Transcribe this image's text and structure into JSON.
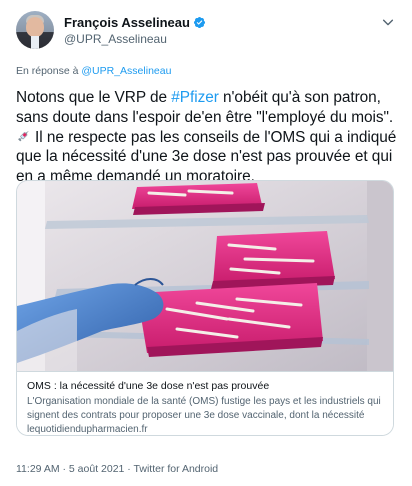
{
  "author": {
    "display_name": "François Asselineau",
    "handle": "@UPR_Asselineau",
    "verified": true
  },
  "reply": {
    "prefix": "En réponse à",
    "mention": "@UPR_Asselineau"
  },
  "tweet": {
    "line1_a": "Notons que le VRP de ",
    "hashtag": "#Pfizer",
    "line1_b": " n'obéit qu'à son patron, sans doute dans l'espoir de'en être \"l'employé du mois\".",
    "emoji_name": "syringe-icon",
    "line2": "Il ne respecte pas les conseils de l'OMS qui a indiqué que la nécessité d'une 3e dose n'est pas prouvée et qui en a même demandé un moratoire."
  },
  "card": {
    "title": "OMS : la nécessité d'une 3e dose n'est pas prouvée",
    "description": "L'Organisation mondiale de la santé (OMS) fustige les pays et les industriels qui signent des contrats pour proposer une 3e dose vaccinale, dont la nécessité n'e...",
    "domain": "lequotidiendupharmacien.fr"
  },
  "meta": {
    "timestamp": "11:29 AM · 5 août 2021 · Twitter for Android"
  },
  "colors": {
    "accent": "#1d9bf0",
    "text": "#0f1419",
    "secondary": "#536471",
    "tray": "#e4257f",
    "glove": "#4a7fc8"
  }
}
